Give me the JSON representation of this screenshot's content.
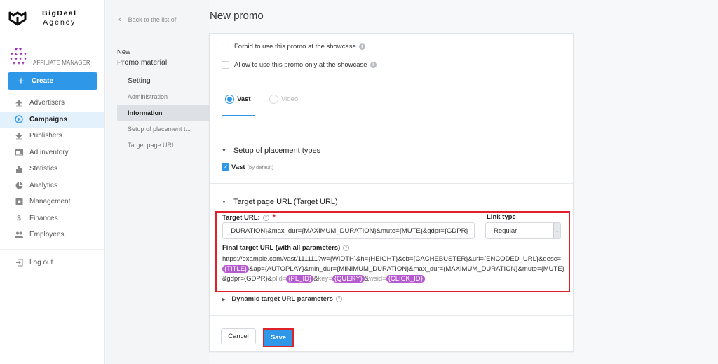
{
  "brand": {
    "line1": "BigDeal",
    "line2": "Agency"
  },
  "role": {
    "label": "AFFILIATE MANAGER"
  },
  "sidebar": {
    "create_label": "Create",
    "items": [
      {
        "label": "Advertisers",
        "icon": "upload-icon"
      },
      {
        "label": "Campaigns",
        "icon": "play-circle-icon",
        "active": true
      },
      {
        "label": "Publishers",
        "icon": "download-icon"
      },
      {
        "label": "Ad inventory",
        "icon": "inventory-icon"
      },
      {
        "label": "Statistics",
        "icon": "bar-chart-icon"
      },
      {
        "label": "Analytics",
        "icon": "pie-chart-icon"
      },
      {
        "label": "Management",
        "icon": "settings-box-icon"
      },
      {
        "label": "Finances",
        "icon": "dollar-icon"
      },
      {
        "label": "Employees",
        "icon": "people-icon"
      }
    ],
    "logout_label": "Log out"
  },
  "subnav": {
    "back_label": "Back to the list of",
    "new_label": "New",
    "promo_label": "Promo material",
    "setting_label": "Setting",
    "items": [
      {
        "label": "Administration"
      },
      {
        "label": "Information",
        "active": true
      },
      {
        "label": "Setup of placement t..."
      },
      {
        "label": "Target page URL"
      }
    ]
  },
  "page": {
    "title": "New promo"
  },
  "form": {
    "forbid_showcase": {
      "label": "Forbid to use this promo at the showcase",
      "checked": false
    },
    "allow_only_showcase": {
      "label": "Allow to use this promo only at the showcase",
      "checked": false
    },
    "tabs": [
      {
        "label": "Vast",
        "selected": true
      },
      {
        "label": "Video",
        "selected": false
      }
    ],
    "placement_section": {
      "title": "Setup of placement types",
      "vast_label": "Vast",
      "vast_note": "(by default)",
      "vast_checked": true
    },
    "target_section": {
      "title": "Target page URL (Target URL)",
      "target_url_label": "Target URL:",
      "required_mark": "*",
      "target_url_value": "_DURATION}&max_dur={MAXIMUM_DURATION}&mute={MUTE}&gdpr={GDPR}",
      "link_type_label": "Link type",
      "link_type_value": "Regular",
      "final_url_label": "Final target URL (with all parameters)",
      "final_url": {
        "part1": "https://example.com/vast/111111?w={WIDTH}&h={HEIGHT}&cb={CACHEBUSTER}&url={ENCODED_URL}&desc=",
        "tag_title": "{TITLE}",
        "part2": "&ap={AUTOPLAY}&min_dur={MINIMUM_DURATION}&max_dur={MAXIMUM_DURATION}&mute={MUTE}&gdpr={GDPR}&",
        "plid_key": "plid=",
        "tag_plid": "{PL_ID}",
        "amp1": "&",
        "key_key": "key=",
        "tag_query": "{QUERY}",
        "amp2": "&",
        "wsid_key": "wsid=",
        "tag_click": "{CLICK_ID}"
      }
    },
    "dynamic_params_label": "Dynamic target URL parameters",
    "cancel_label": "Cancel",
    "save_label": "Save"
  },
  "colors": {
    "accent": "#2f97e8",
    "highlight": "#e0202a",
    "tag": "#b55ad1"
  }
}
